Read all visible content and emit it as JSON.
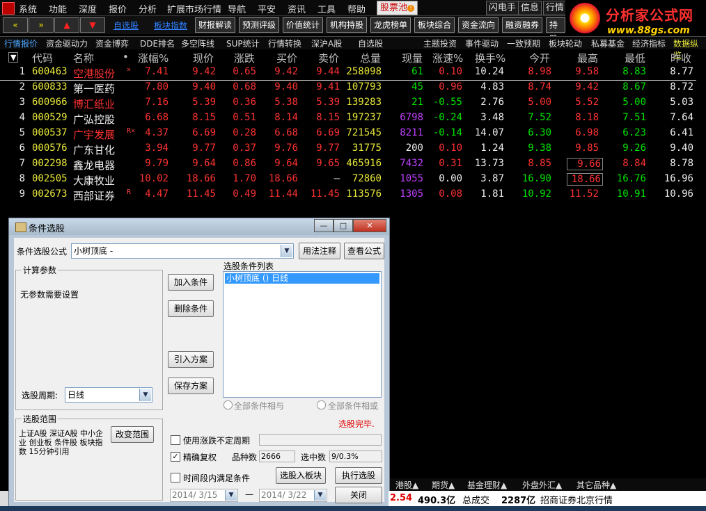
{
  "menu": [
    "系统",
    "功能",
    "深度",
    "报价",
    "分析",
    "扩展市场行情",
    "导航",
    "平安",
    "资讯",
    "工具",
    "帮助"
  ],
  "gupiaochi_label": "股票池",
  "right_buttons": [
    "闪电手",
    "信息",
    "行情"
  ],
  "brand": {
    "title": "分析家公式网",
    "url": "www.88gs.com"
  },
  "toolbar": {
    "links": [
      "自选股",
      "板块指数"
    ],
    "buttons": [
      "财报解读",
      "预测评级",
      "价值统计",
      "机构持股",
      "龙虎榜单",
      "板块综合",
      "资金流向",
      "融资融券",
      "持股"
    ]
  },
  "tabs": [
    "行情报价",
    "资金驱动力",
    "资金博弈",
    "DDE排名",
    "多空阵线",
    "SUP统计",
    "行情转换",
    "深沪A股",
    "自选股",
    "主题投资",
    "事件驱动",
    "一致预期",
    "板块轮动",
    "私募基金",
    "经济指标",
    "数据纵览"
  ],
  "table": {
    "headers": [
      "代码",
      "名称",
      "•",
      "涨幅%",
      "现价",
      "涨跌",
      "买价",
      "卖价",
      "总量",
      "现量",
      "涨速%",
      "换手%",
      "今开",
      "最高",
      "最低",
      "昨收"
    ],
    "rows": [
      {
        "n": "1",
        "code": "600463",
        "name": "空港股份",
        "mark": "×",
        "chg_pct": "7.41",
        "price": "9.42",
        "chg": "0.65",
        "bid": "9.42",
        "ask": "9.44",
        "vol": "258098",
        "cur_vol": "61",
        "speed": "0.10",
        "turnover": "10.24",
        "open": "8.98",
        "high": "9.58",
        "low": "8.83",
        "prev": "8.77"
      },
      {
        "n": "2",
        "code": "600833",
        "name": "第一医药",
        "mark": "",
        "chg_pct": "7.80",
        "price": "9.40",
        "chg": "0.68",
        "bid": "9.40",
        "ask": "9.41",
        "vol": "107793",
        "cur_vol": "45",
        "speed": "0.96",
        "turnover": "4.83",
        "open": "8.74",
        "high": "9.42",
        "low": "8.67",
        "prev": "8.72"
      },
      {
        "n": "3",
        "code": "600966",
        "name": "博汇纸业",
        "mark": "",
        "chg_pct": "7.16",
        "price": "5.39",
        "chg": "0.36",
        "bid": "5.38",
        "ask": "5.39",
        "vol": "139283",
        "cur_vol": "21",
        "speed": "-0.55",
        "turnover": "2.76",
        "open": "5.00",
        "high": "5.52",
        "low": "5.00",
        "prev": "5.03"
      },
      {
        "n": "4",
        "code": "000529",
        "name": "广弘控股",
        "mark": "",
        "chg_pct": "6.68",
        "price": "8.15",
        "chg": "0.51",
        "bid": "8.14",
        "ask": "8.15",
        "vol": "197237",
        "cur_vol": "6798",
        "speed": "-0.24",
        "turnover": "3.48",
        "open": "7.52",
        "high": "8.18",
        "low": "7.51",
        "prev": "7.64"
      },
      {
        "n": "5",
        "code": "000537",
        "name": "广宇发展",
        "mark": "R×",
        "chg_pct": "4.37",
        "price": "6.69",
        "chg": "0.28",
        "bid": "6.68",
        "ask": "6.69",
        "vol": "721545",
        "cur_vol": "8211",
        "speed": "-0.14",
        "turnover": "14.07",
        "open": "6.30",
        "high": "6.98",
        "low": "6.23",
        "prev": "6.41"
      },
      {
        "n": "6",
        "code": "000576",
        "name": "广东甘化",
        "mark": "",
        "chg_pct": "3.94",
        "price": "9.77",
        "chg": "0.37",
        "bid": "9.76",
        "ask": "9.77",
        "vol": "31775",
        "cur_vol": "200",
        "speed": "0.10",
        "turnover": "1.24",
        "open": "9.38",
        "high": "9.85",
        "low": "9.26",
        "prev": "9.40"
      },
      {
        "n": "7",
        "code": "002298",
        "name": "鑫龙电器",
        "mark": "",
        "chg_pct": "9.79",
        "price": "9.64",
        "chg": "0.86",
        "bid": "9.64",
        "ask": "9.65",
        "vol": "465916",
        "cur_vol": "7432",
        "speed": "0.31",
        "turnover": "13.73",
        "open": "8.85",
        "high": "9.66",
        "low": "8.84",
        "prev": "8.78"
      },
      {
        "n": "8",
        "code": "002505",
        "name": "大康牧业",
        "mark": "",
        "chg_pct": "10.02",
        "price": "18.66",
        "chg": "1.70",
        "bid": "18.66",
        "ask": "—",
        "vol": "72860",
        "cur_vol": "1055",
        "speed": "0.00",
        "turnover": "3.87",
        "open": "16.90",
        "high": "18.66",
        "low": "16.76",
        "prev": "16.96"
      },
      {
        "n": "9",
        "code": "002673",
        "name": "西部证券",
        "mark": "R",
        "chg_pct": "4.47",
        "price": "11.45",
        "chg": "0.49",
        "bid": "11.44",
        "ask": "11.45",
        "vol": "113576",
        "cur_vol": "1305",
        "speed": "0.08",
        "turnover": "1.81",
        "open": "10.92",
        "high": "11.52",
        "low": "10.91",
        "prev": "10.96"
      }
    ]
  },
  "dialog": {
    "title": "条件选股",
    "formula_label": "条件选股公式",
    "formula_value": "小树顶底 -",
    "btn_usage": "用法注释",
    "btn_view": "查看公式",
    "params_group": "计算参数",
    "params_text": "无参数需要设置",
    "period_label": "选股周期:",
    "period_value": "日线",
    "btn_add": "加入条件",
    "btn_delete": "删除条件",
    "btn_import": "引入方案",
    "btn_save": "保存方案",
    "list_label": "选股条件列表",
    "list_item": "小树顶底  () 日线",
    "radio_and": "全部条件相与",
    "radio_or": "全部条件相或",
    "status_done": "选股完毕.",
    "range_group": "选股范围",
    "range_text": "上证A股 深证A股 中小企业 创业板 条件股 板块指数 15分钟引用",
    "btn_change_range": "改变范围",
    "chk_uncertain": "使用涨跌不定周期",
    "chk_exact": "精确复权",
    "count_label": "品种数",
    "count_value": "2666",
    "hit_label": "选中数",
    "hit_value": "9/0.3%",
    "chk_timerange": "时间段内满足条件",
    "btn_to_block": "选股入板块",
    "btn_exec": "执行选股",
    "btn_close": "关闭",
    "date_from": "2014/ 3/15",
    "date_to": "2014/ 3/22",
    "dash": "—"
  },
  "bottom_tabs": [
    "港股▲",
    "期货▲",
    "基金理财▲",
    "外盘外汇▲",
    "其它品种▲"
  ],
  "status": {
    "v1": "2.54",
    "v2": "490.3亿",
    "label": "总成交",
    "v3": "2287亿",
    "broker": "招商证券北京行情"
  }
}
